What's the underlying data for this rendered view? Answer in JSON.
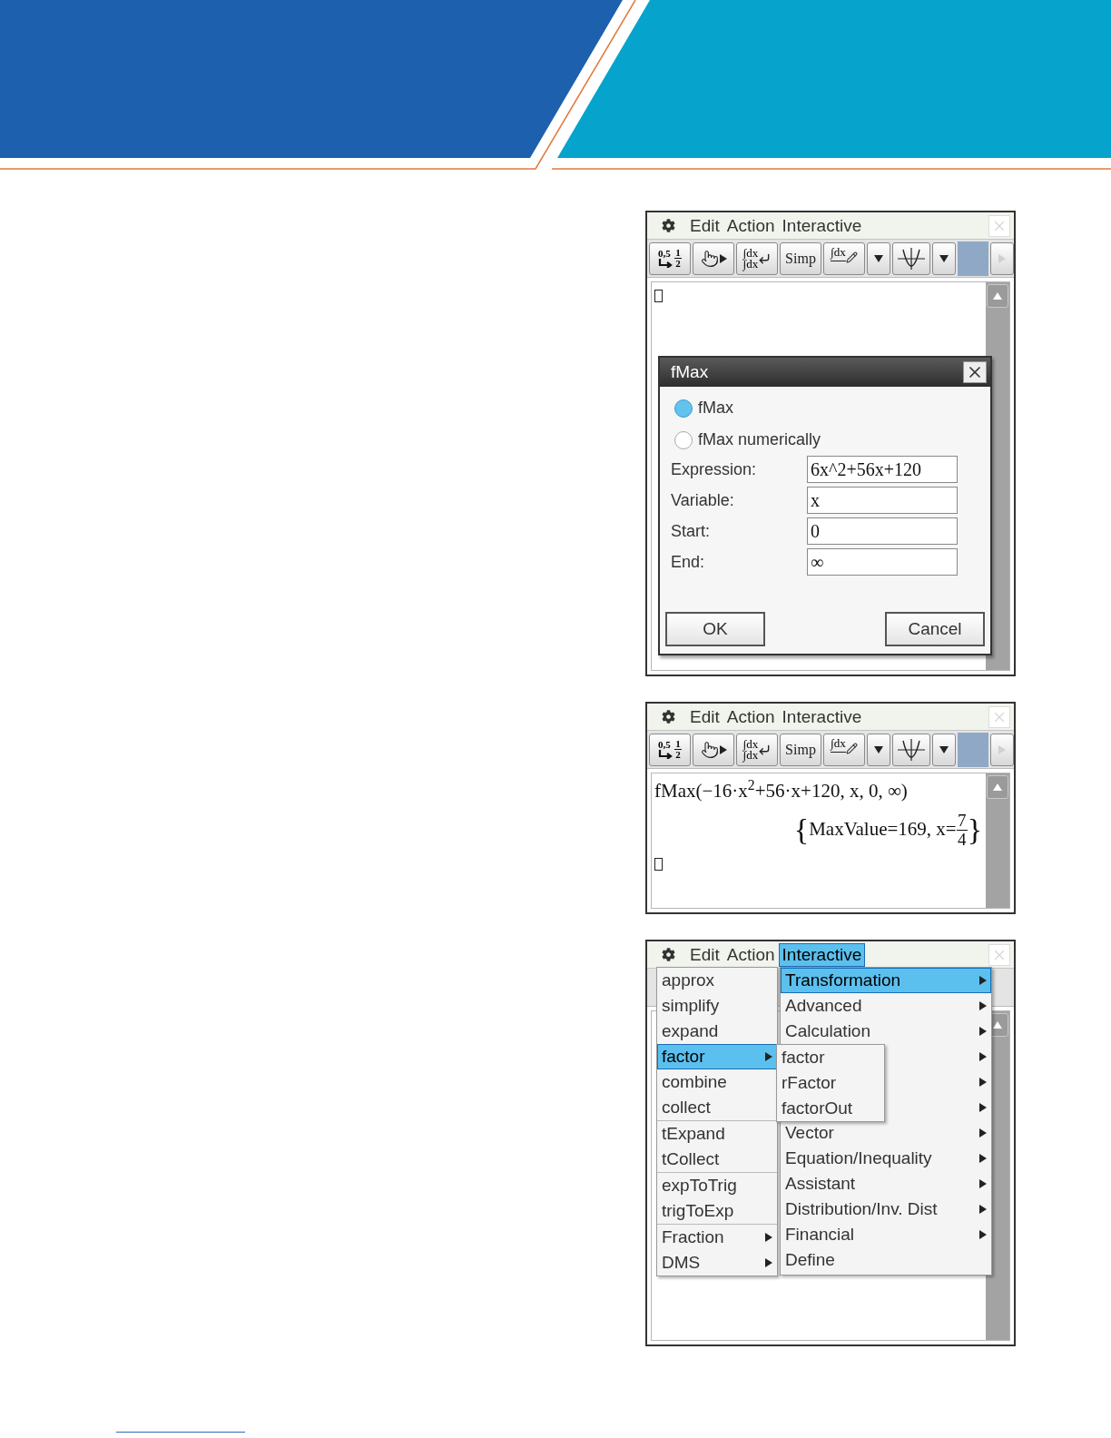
{
  "screens": [
    {
      "menu_bar": {
        "items": [
          {
            "label": "Edit",
            "selected": false
          },
          {
            "label": "Action",
            "selected": false
          },
          {
            "label": "Interactive",
            "selected": false
          }
        ]
      },
      "toolbar": [
        {
          "kind": "convert",
          "labels": [
            "0,5",
            "1",
            "2"
          ]
        },
        {
          "kind": "hand"
        },
        {
          "kind": "integral-swap",
          "labels": [
            "∫dx",
            "∫dx"
          ]
        },
        {
          "kind": "text",
          "label": "Simp"
        },
        {
          "kind": "integral-edit",
          "labels": [
            "∫dx"
          ]
        },
        {
          "kind": "dropdown"
        },
        {
          "kind": "graph"
        },
        {
          "kind": "dropdown"
        },
        {
          "kind": "blank"
        },
        {
          "kind": "arrow"
        }
      ],
      "work_area": {
        "cursor": true
      },
      "dialog": {
        "title": "fMax",
        "options": [
          {
            "label": "fMax",
            "selected": true
          },
          {
            "label": "fMax numerically",
            "selected": false
          }
        ],
        "fields": [
          {
            "label": "Expression:",
            "value": "6x^2+56x+120"
          },
          {
            "label": "Variable:",
            "value": "x"
          },
          {
            "label": "Start:",
            "value": "0"
          },
          {
            "label": "End:",
            "value": "∞"
          }
        ],
        "buttons": [
          "OK",
          "Cancel"
        ]
      }
    },
    {
      "menu_bar": {
        "items": [
          {
            "label": "Edit",
            "selected": false
          },
          {
            "label": "Action",
            "selected": false
          },
          {
            "label": "Interactive",
            "selected": false
          }
        ]
      },
      "toolbar": [
        {
          "kind": "convert",
          "labels": [
            "0,5",
            "1",
            "2"
          ]
        },
        {
          "kind": "hand"
        },
        {
          "kind": "integral-swap",
          "labels": [
            "∫dx",
            "∫dx"
          ]
        },
        {
          "kind": "text",
          "label": "Simp"
        },
        {
          "kind": "integral-edit",
          "labels": [
            "∫dx"
          ]
        },
        {
          "kind": "dropdown"
        },
        {
          "kind": "graph"
        },
        {
          "kind": "dropdown"
        },
        {
          "kind": "blank"
        },
        {
          "kind": "arrow"
        }
      ],
      "work_area": {
        "entries": [
          {
            "input": "fMax(−16·x$^{2}$+56·x+120, x, 0, ∞)",
            "output": {
              "open": "{",
              "text": "MaxValue=169, x=",
              "numerator": "7",
              "denominator": "4",
              "close": "}"
            }
          }
        ],
        "cursor": true
      }
    },
    {
      "menu_bar": {
        "items": [
          {
            "label": "Edit",
            "selected": false
          },
          {
            "label": "Action",
            "selected": false
          },
          {
            "label": "Interactive",
            "selected": true
          }
        ]
      },
      "menus": {
        "main": {
          "groups": [
            [
              {
                "label": "approx",
                "selected": false,
                "submenu": false
              },
              {
                "label": "simplify",
                "selected": false,
                "submenu": false
              },
              {
                "label": "expand",
                "selected": false,
                "submenu": false
              },
              {
                "label": "factor",
                "selected": true,
                "submenu": true
              },
              {
                "label": "combine",
                "selected": false,
                "submenu": false
              },
              {
                "label": "collect",
                "selected": false,
                "submenu": false
              }
            ],
            [
              {
                "label": "tExpand",
                "selected": false,
                "submenu": false
              },
              {
                "label": "tCollect",
                "selected": false,
                "submenu": false
              }
            ],
            [
              {
                "label": "expToTrig",
                "selected": false,
                "submenu": false
              },
              {
                "label": "trigToExp",
                "selected": false,
                "submenu": false
              }
            ],
            [
              {
                "label": "Fraction",
                "selected": false,
                "submenu": true
              },
              {
                "label": "DMS",
                "selected": false,
                "submenu": true
              }
            ]
          ]
        },
        "interactive": {
          "items": [
            {
              "label": "Transformation",
              "selected": true,
              "submenu": true
            },
            {
              "label": "Advanced",
              "selected": false,
              "submenu": true
            },
            {
              "label": "Calculation",
              "selected": false,
              "submenu": true
            },
            {
              "submenu": true
            },
            {
              "submenu": true
            },
            {
              "submenu": true
            },
            {
              "label": "Vector",
              "selected": false,
              "submenu": true
            },
            {
              "label": "Equation/Inequality",
              "selected": false,
              "submenu": true
            },
            {
              "label": "Assistant",
              "selected": false,
              "submenu": true
            },
            {
              "label": "Distribution/Inv. Dist",
              "selected": false,
              "submenu": true
            },
            {
              "label": "Financial",
              "selected": false,
              "submenu": true
            },
            {
              "label": "Define",
              "selected": false,
              "submenu": false
            }
          ]
        },
        "factor": {
          "items": [
            {
              "label": "factor",
              "selected": false
            },
            {
              "label": "rFactor",
              "selected": false
            },
            {
              "label": "factorOut",
              "selected": false
            }
          ]
        }
      }
    }
  ]
}
